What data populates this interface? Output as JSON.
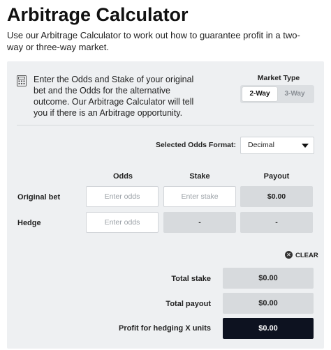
{
  "page": {
    "title": "Arbitrage Calculator",
    "subtitle": "Use our Arbitrage Calculator to work out how to guarantee profit in a two-way or three-way market."
  },
  "intro": "Enter the Odds and Stake of your original bet and the Odds for the alternative outcome. Our Arbitrage Calculator will tell you if there is an Arbitrage opportunity.",
  "market_type": {
    "label": "Market Type",
    "options": [
      "2-Way",
      "3-Way"
    ],
    "selected": "2-Way"
  },
  "odds_format": {
    "label": "Selected Odds Format:",
    "value": "Decimal"
  },
  "columns": [
    "Odds",
    "Stake",
    "Payout"
  ],
  "rows": {
    "original": {
      "label": "Original bet",
      "odds_placeholder": "Enter odds",
      "stake_placeholder": "Enter stake",
      "payout": "$0.00"
    },
    "hedge": {
      "label": "Hedge",
      "odds_placeholder": "Enter odds",
      "stake": "-",
      "payout": "-"
    }
  },
  "clear_label": "CLEAR",
  "totals": {
    "total_stake": {
      "label": "Total stake",
      "value": "$0.00"
    },
    "total_payout": {
      "label": "Total payout",
      "value": "$0.00"
    },
    "profit": {
      "label": "Profit for hedging X units",
      "value": "$0.00"
    }
  },
  "icons": {
    "calculator": "calculator-icon",
    "dropdown": "caret-down-icon",
    "clear": "close-circle-icon"
  },
  "colors": {
    "panel_bg": "#eef0f2",
    "output_bg": "#d7dadd",
    "profit_bg": "#0d1220"
  }
}
